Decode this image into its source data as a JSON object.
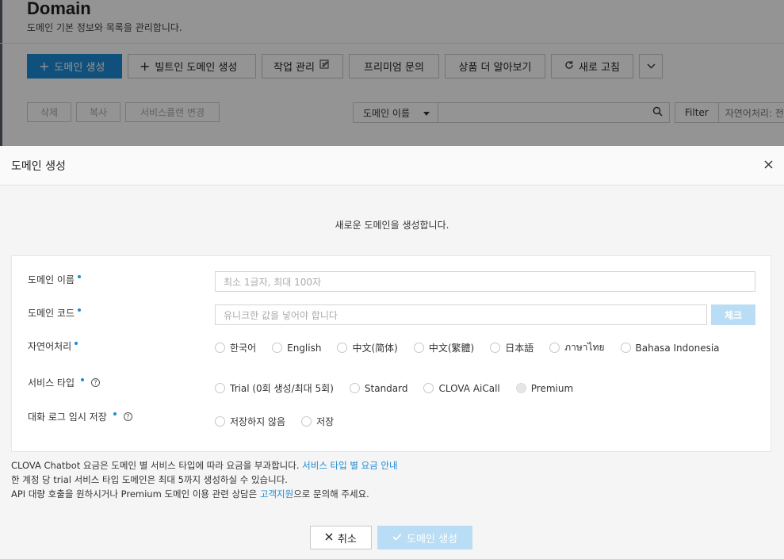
{
  "background": {
    "title": "Domain",
    "subtitle": "도메인 기본 정보와 목록을 관리합니다.",
    "toolbar": {
      "create_domain": "도메인 생성",
      "create_builtin": "빌트인 도메인 생성",
      "job_manage": "작업 관리",
      "premium_inquiry": "프리미엄 문의",
      "learn_more": "상품 더 알아보기",
      "refresh": "새로 고침"
    },
    "actions": {
      "delete": "삭제",
      "copy": "복사",
      "change_plan": "서비스플랜 변경"
    },
    "search": {
      "select_value": "도메인 이름",
      "filter": "Filter",
      "filter_value": "자연어처리: 전체"
    }
  },
  "modal": {
    "title": "도메인 생성",
    "intro": "새로운 도메인을 생성합니다.",
    "form": {
      "domain_name_label": "도메인 이름",
      "domain_name_placeholder": "최소 1글자, 최대 100자",
      "domain_code_label": "도메인 코드",
      "domain_code_placeholder": "유니크한 값을 넣어야 합니다",
      "check_button": "체크",
      "nlp_label": "자연어처리",
      "nlp_options": [
        "한국어",
        "English",
        "中文(简体)",
        "中文(繁體)",
        "日本語",
        "ภาษาไทย",
        "Bahasa Indonesia"
      ],
      "service_type_label": "서비스 타입",
      "service_type_options": [
        "Trial (0회 생성/최대 5회)",
        "Standard",
        "CLOVA AiCall",
        "Premium"
      ],
      "chat_log_label": "대화 로그 임시 저장",
      "chat_log_options": [
        "저장하지 않음",
        "저장"
      ]
    },
    "info": {
      "line1_text": "CLOVA Chatbot 요금은 도메인 별 서비스 타입에 따라 요금을 부과합니다. ",
      "line1_link": "서비스 타입 별 요금 안내",
      "line2_text": "한 계정 당 trial 서비스 타입 도메인은 최대 5까지 생성하실 수 있습니다.",
      "line3_pre": "API 대량 호출을 원하시거나 Premium 도메인 이용 관련 상담은 ",
      "line3_link": "고객지원",
      "line3_post": "으로 문의해 주세요."
    },
    "buttons": {
      "cancel": "취소",
      "create": "도메인 생성"
    }
  }
}
